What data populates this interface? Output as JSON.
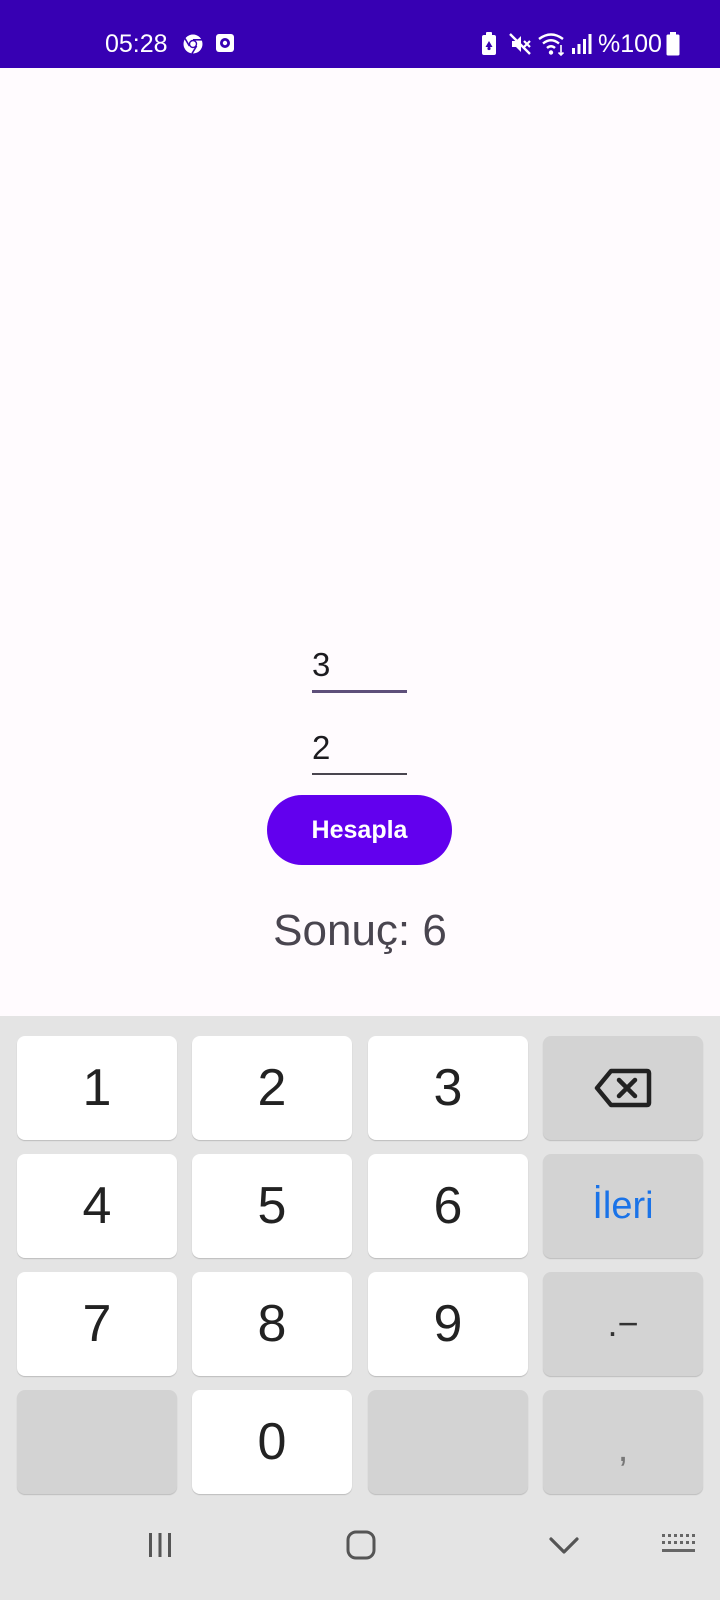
{
  "status_bar": {
    "time": "05:28",
    "battery_text": "%100",
    "background_color": "#3700B3",
    "icons": [
      "chrome-icon",
      "notification-app-icon",
      "battery-saver-icon",
      "mute-icon",
      "wifi-icon",
      "signal-icon",
      "battery-icon"
    ]
  },
  "form": {
    "first_number": "3",
    "second_number": "2",
    "button_label": "Hesapla",
    "result_text": "Sonuç: 6",
    "accent_color": "#6200EE"
  },
  "keyboard": {
    "rows": [
      [
        "1",
        "2",
        "3",
        "backspace"
      ],
      [
        "4",
        "5",
        "6",
        "İleri"
      ],
      [
        "7",
        "8",
        "9",
        ".−"
      ],
      [
        "",
        "0",
        "",
        ","
      ]
    ],
    "next_label": "İleri",
    "symbol_label": ".−",
    "comma_label": ","
  },
  "nav_bar": {
    "icons": [
      "recent-apps-icon",
      "home-icon",
      "back-icon",
      "keyboard-switch-icon"
    ]
  }
}
